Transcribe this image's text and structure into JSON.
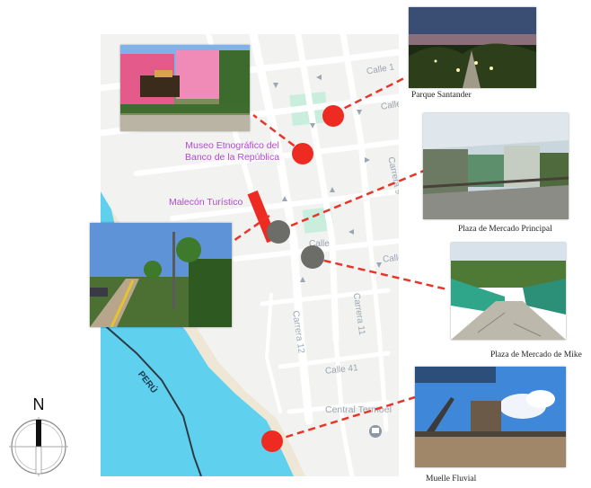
{
  "map": {
    "streets": [
      "Calle 1",
      "Calle",
      "Carrera 9",
      "Carrera 11",
      "Carrera 12",
      "Calle 4",
      "Calle 41",
      "Calle"
    ],
    "places": [
      "Central Termoel"
    ],
    "border_label": "PERÚ",
    "colors": {
      "river": "#5fd0ee",
      "land": "#f2f2f0",
      "park": "#c9eedd",
      "road": "#ffffff"
    }
  },
  "labels": {
    "museo_line1": "Museo Etnográfico del",
    "museo_line2": "Banco de la República",
    "malecon": "Malecón Turístico"
  },
  "captions": {
    "parque": "Parque Santander",
    "plaza_principal": "Plaza de Mercado Principal",
    "plaza_mike": "Plaza de Mercado de Mike",
    "muelle": "Muelle Fluvial"
  },
  "compass": {
    "north": "N"
  },
  "colors": {
    "marker_red": "#ee2b22",
    "marker_gray": "#6c6c68",
    "connector": "#e8352a",
    "label_purple": "#b548d8"
  }
}
